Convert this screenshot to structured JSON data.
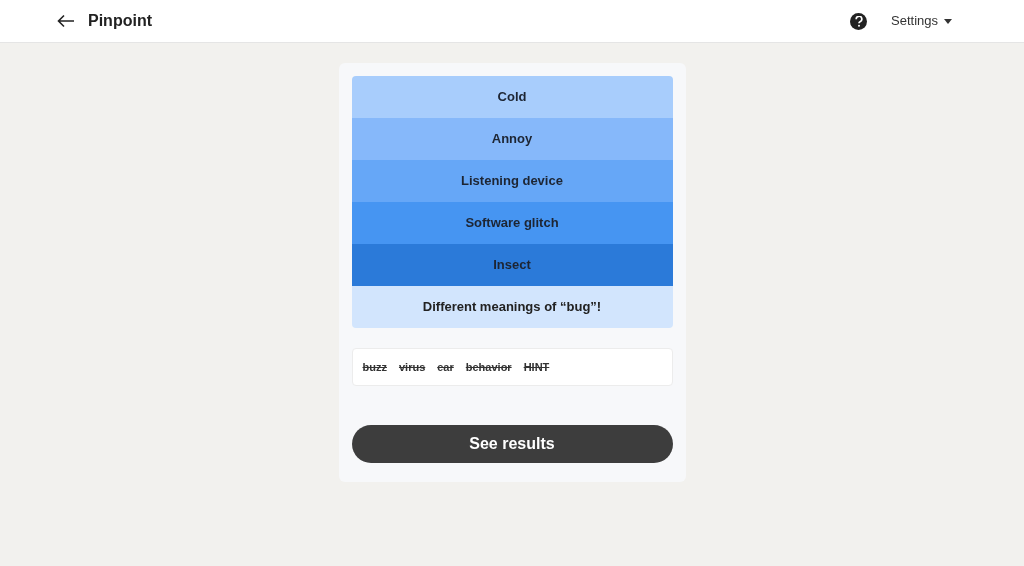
{
  "header": {
    "title": "Pinpoint",
    "settings": "Settings"
  },
  "clues": [
    {
      "text": "Cold",
      "color": "#a8cdfc"
    },
    {
      "text": "Annoy",
      "color": "#86b8fa"
    },
    {
      "text": "Listening device",
      "color": "#66a7f7"
    },
    {
      "text": "Software glitch",
      "color": "#4695f2"
    },
    {
      "text": "Insect",
      "color": "#2b7ad9"
    }
  ],
  "answer": "Different meanings of “bug”!",
  "guesses": [
    {
      "text": "buzz",
      "struck": true
    },
    {
      "text": "virus",
      "struck": true
    },
    {
      "text": "ear",
      "struck": true
    },
    {
      "text": "behavior",
      "struck": true
    },
    {
      "text": "HINT",
      "struck": true
    }
  ],
  "button": "See results"
}
